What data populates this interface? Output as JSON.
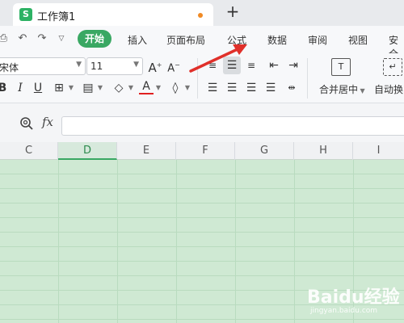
{
  "tab": {
    "logo_text": "S",
    "title": "工作簿1",
    "new_tab": "+"
  },
  "menu": {
    "items": [
      "开始",
      "插入",
      "页面布局",
      "公式",
      "数据",
      "审阅",
      "视图",
      "安全"
    ],
    "active": "开始"
  },
  "ribbon": {
    "font_name": "宋体",
    "font_size": "11",
    "merge_center_label": "合并居中",
    "auto_wrap_label": "自动换",
    "font_color": "#e02020"
  },
  "formula_bar": {
    "fx": "fx",
    "value": ""
  },
  "columns": [
    "C",
    "D",
    "E",
    "F",
    "G",
    "H",
    "I"
  ],
  "selected_column": "D",
  "watermark": {
    "main": "Baidu经验",
    "sub": "jingyan.baidu.com"
  }
}
